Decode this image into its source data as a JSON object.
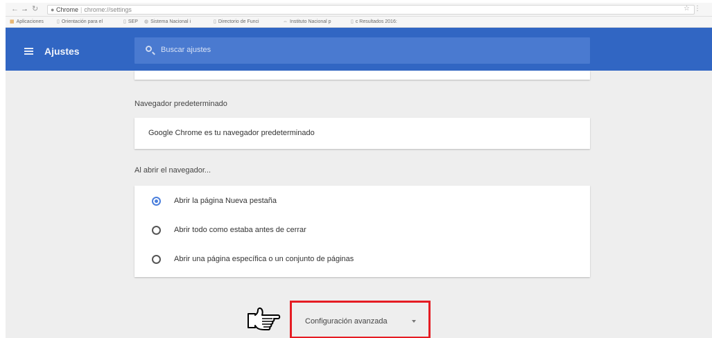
{
  "browser": {
    "address": {
      "site_label": "Chrome",
      "url_path": "chrome://settings"
    },
    "bookmarks": [
      {
        "label": "Aplicaciones"
      },
      {
        "label": "Orientación para el"
      },
      {
        "label": "SEP"
      },
      {
        "label": "Sistema Nacional i"
      },
      {
        "label": "Directorio de Funci"
      },
      {
        "label": "Instituto Nacional p"
      },
      {
        "label": "c Resultados 2016:"
      }
    ]
  },
  "header": {
    "title": "Ajustes",
    "search_placeholder": "Buscar ajustes"
  },
  "default_browser": {
    "heading": "Navegador predeterminado",
    "status": "Google Chrome es tu navegador predeterminado"
  },
  "on_startup": {
    "heading": "Al abrir el navegador...",
    "options": [
      {
        "label": "Abrir la página Nueva pestaña",
        "selected": true
      },
      {
        "label": "Abrir todo como estaba antes de cerrar",
        "selected": false
      },
      {
        "label": "Abrir una página específica o un conjunto de páginas",
        "selected": false
      }
    ]
  },
  "advanced": {
    "label": "Configuración avanzada"
  },
  "colors": {
    "header": "#3166c3",
    "highlight": "#e51c23",
    "radio_selected": "#4b7fdc"
  }
}
